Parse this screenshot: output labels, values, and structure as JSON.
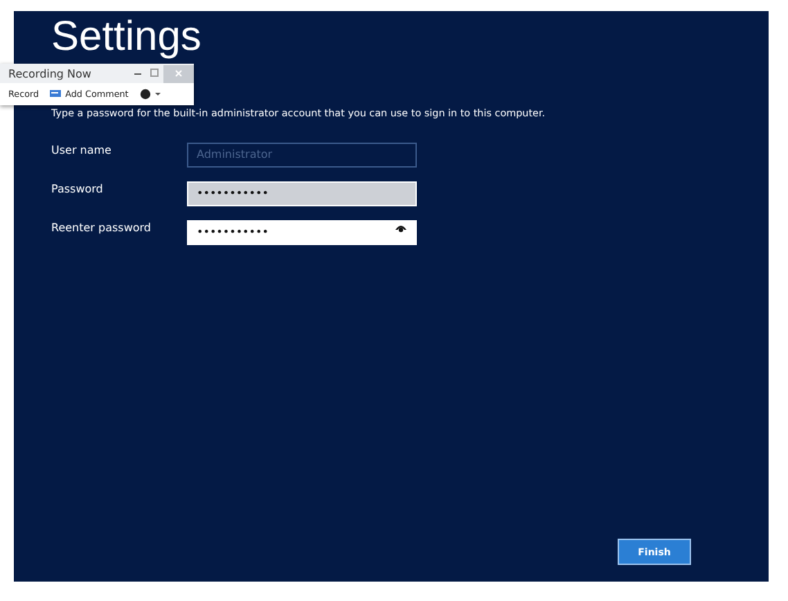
{
  "title": "Settings",
  "instruction": "Type a password for the built-in administrator account that you can use to sign in to this computer.",
  "fields": [
    {
      "label": "User name",
      "placeholder": "Administrator",
      "disabled": true,
      "focused": false
    },
    {
      "label": "Password",
      "value": "•••••••••••",
      "disabled": false,
      "focused": false
    },
    {
      "label": "Reenter password",
      "value": "•••••••••••",
      "disabled": false,
      "focused": true,
      "reveal": true
    }
  ],
  "finish_button": "Finish",
  "recorder": {
    "title": "Recording Now",
    "record": "Record",
    "add_comment": "Add Comment"
  }
}
